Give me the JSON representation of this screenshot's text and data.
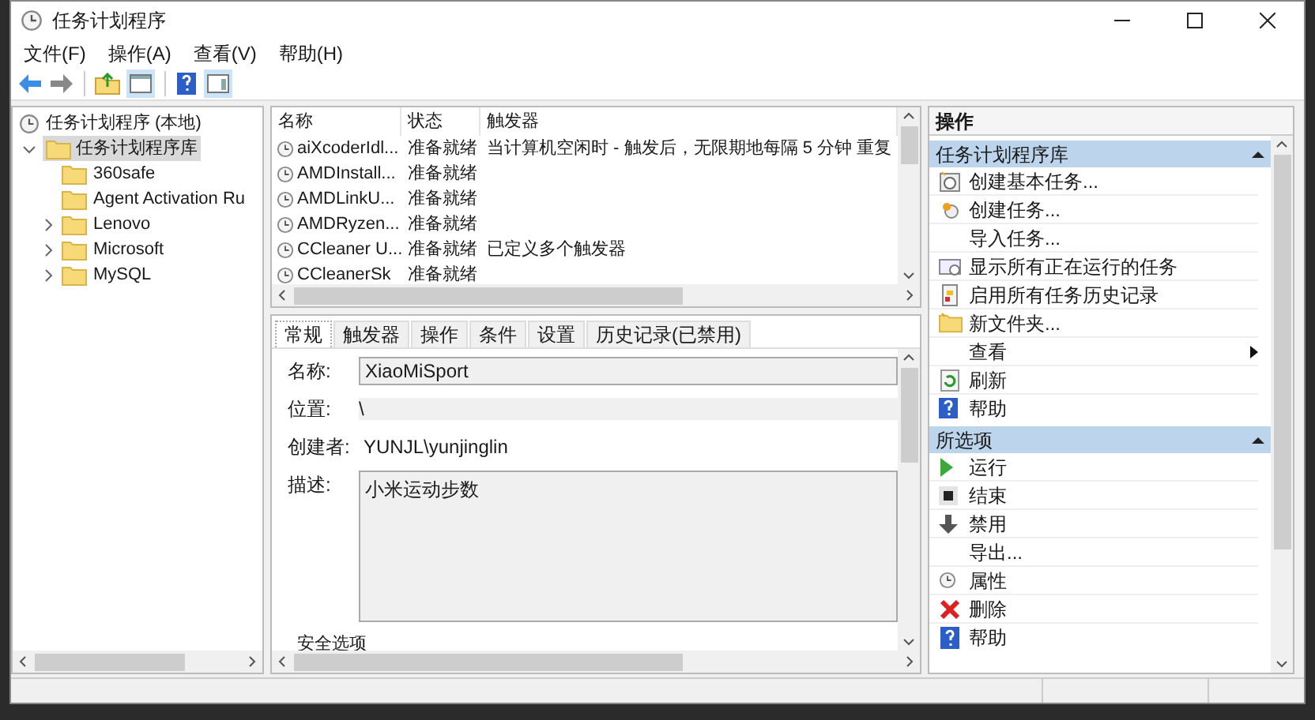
{
  "window": {
    "title": "任务计划程序"
  },
  "menu": [
    "文件(F)",
    "操作(A)",
    "查看(V)",
    "帮助(H)"
  ],
  "tree": {
    "root": "任务计划程序 (本地)",
    "items": [
      {
        "label": "任务计划程序库",
        "expanded": true,
        "selected": true,
        "children": [
          {
            "label": "360safe",
            "expandable": false
          },
          {
            "label": "Agent Activation Ru",
            "expandable": false
          },
          {
            "label": "Lenovo",
            "expandable": true
          },
          {
            "label": "Microsoft",
            "expandable": true
          },
          {
            "label": "MySQL",
            "expandable": true
          }
        ]
      }
    ]
  },
  "task_list": {
    "columns": [
      "名称",
      "状态",
      "触发器"
    ],
    "rows": [
      {
        "name": "aiXcoderIdl...",
        "status": "准备就绪",
        "trigger": "当计算机空闲时 - 触发后，无限期地每隔 5 分钟 重复"
      },
      {
        "name": "AMDInstall...",
        "status": "准备就绪"
      },
      {
        "name": "AMDLinkU...",
        "status": "准备就绪"
      },
      {
        "name": "AMDRyzen...",
        "status": "准备就绪"
      },
      {
        "name": "CCleaner U...",
        "status": "准备就绪",
        "trigger": "已定义多个触发器"
      },
      {
        "name": "CCleanerSk",
        "status": "准备就绪"
      }
    ]
  },
  "details": {
    "tabs": [
      {
        "label": "常规",
        "selected": true
      },
      {
        "label": "触发器",
        "selected": false
      },
      {
        "label": "操作",
        "selected": false
      },
      {
        "label": "条件",
        "selected": false
      },
      {
        "label": "设置",
        "selected": false
      },
      {
        "label": "历史记录(已禁用)",
        "selected": false
      }
    ],
    "fields": [
      {
        "kind": "input",
        "label": "名称:",
        "value": "XiaoMiSport"
      },
      {
        "kind": "readonly",
        "label": "位置:",
        "value": "\\"
      },
      {
        "kind": "plain",
        "label": "创建者:",
        "value": "YUNJL\\yunjinglin"
      },
      {
        "kind": "textarea",
        "label": "描述:",
        "value": "小米运动步数"
      }
    ],
    "section": "安全选项"
  },
  "actions": {
    "title": "操作",
    "groups": [
      {
        "title": "任务计划程序库",
        "items": [
          {
            "label": "创建基本任务..."
          },
          {
            "label": "创建任务..."
          },
          {
            "label": "导入任务..."
          },
          {
            "label": "显示所有正在运行的任务"
          },
          {
            "label": "启用所有任务历史记录"
          },
          {
            "label": "新文件夹..."
          },
          {
            "label": "查看",
            "submenu": true
          },
          {
            "label": "刷新"
          },
          {
            "label": "帮助"
          }
        ]
      },
      {
        "title": "所选项",
        "items": [
          {
            "label": "运行"
          },
          {
            "label": "结束"
          },
          {
            "label": "禁用"
          },
          {
            "label": "导出..."
          },
          {
            "label": "属性"
          },
          {
            "label": "删除"
          },
          {
            "label": "帮助"
          }
        ]
      }
    ]
  }
}
